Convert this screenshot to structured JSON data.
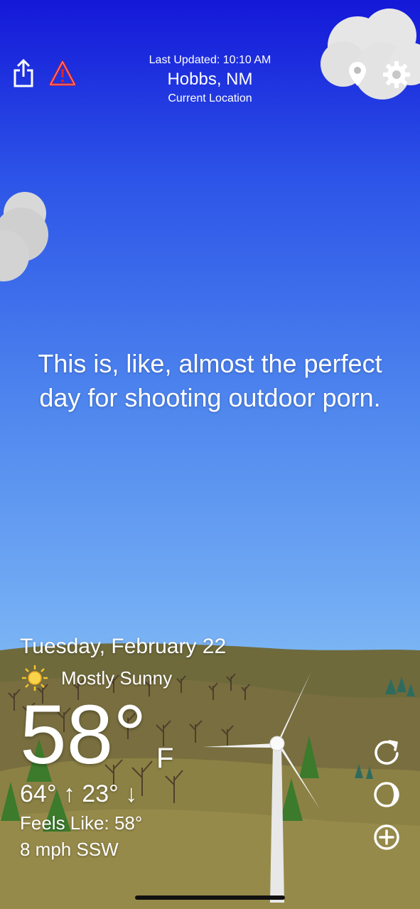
{
  "header": {
    "last_updated": "Last Updated: 10:10 AM",
    "city": "Hobbs, NM",
    "location_label": "Current Location"
  },
  "icons": {
    "share": "share-icon",
    "alert": "warning-icon",
    "location": "location-pin-icon",
    "settings": "gear-icon",
    "refresh": "refresh-icon",
    "moon": "moon-phase-icon",
    "add": "add-icon",
    "condition": "sun-icon"
  },
  "joke": {
    "line1": "This is, like, almost the perfect",
    "line2": "day for shooting outdoor porn."
  },
  "weather": {
    "date": "Tuesday, February 22",
    "condition": "Mostly Sunny",
    "temperature": "58°",
    "unit": "F",
    "high_low": "64° ↑  23° ↓",
    "feels_like": "Feels Like: 58°",
    "wind": "8 mph SSW"
  },
  "colors": {
    "sky_top": "#1418d8",
    "sky_bottom": "#8cc4f5",
    "hills": "#6b6a3a",
    "alert_red": "#e02020",
    "sun_yellow": "#f7c52a"
  }
}
